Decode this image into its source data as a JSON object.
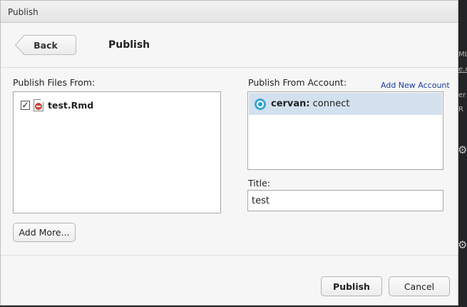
{
  "window": {
    "title": "Publish"
  },
  "header": {
    "back_label": "Back",
    "heading": "Publish"
  },
  "files": {
    "label": "Publish Files From:",
    "items": [
      {
        "name": "test.Rmd",
        "checked": true,
        "check_glyph": "✓"
      }
    ],
    "add_more_label": "Add More..."
  },
  "account": {
    "label": "Publish From Account:",
    "add_new_label": "Add New Account",
    "items": [
      {
        "user": "cervan:",
        "server": "connect",
        "selected": true
      }
    ]
  },
  "title_field": {
    "label": "Title:",
    "value": "test"
  },
  "footer": {
    "publish_label": "Publish",
    "cancel_label": "Cancel"
  },
  "background_fragments": [
    "ML",
    "e.c",
    "er",
    "R"
  ],
  "colors": {
    "selection": "#d3e1ef",
    "link": "#1a3aa3",
    "rmd_icon": "#c9453d",
    "server_icon": "#1e9fd4"
  }
}
